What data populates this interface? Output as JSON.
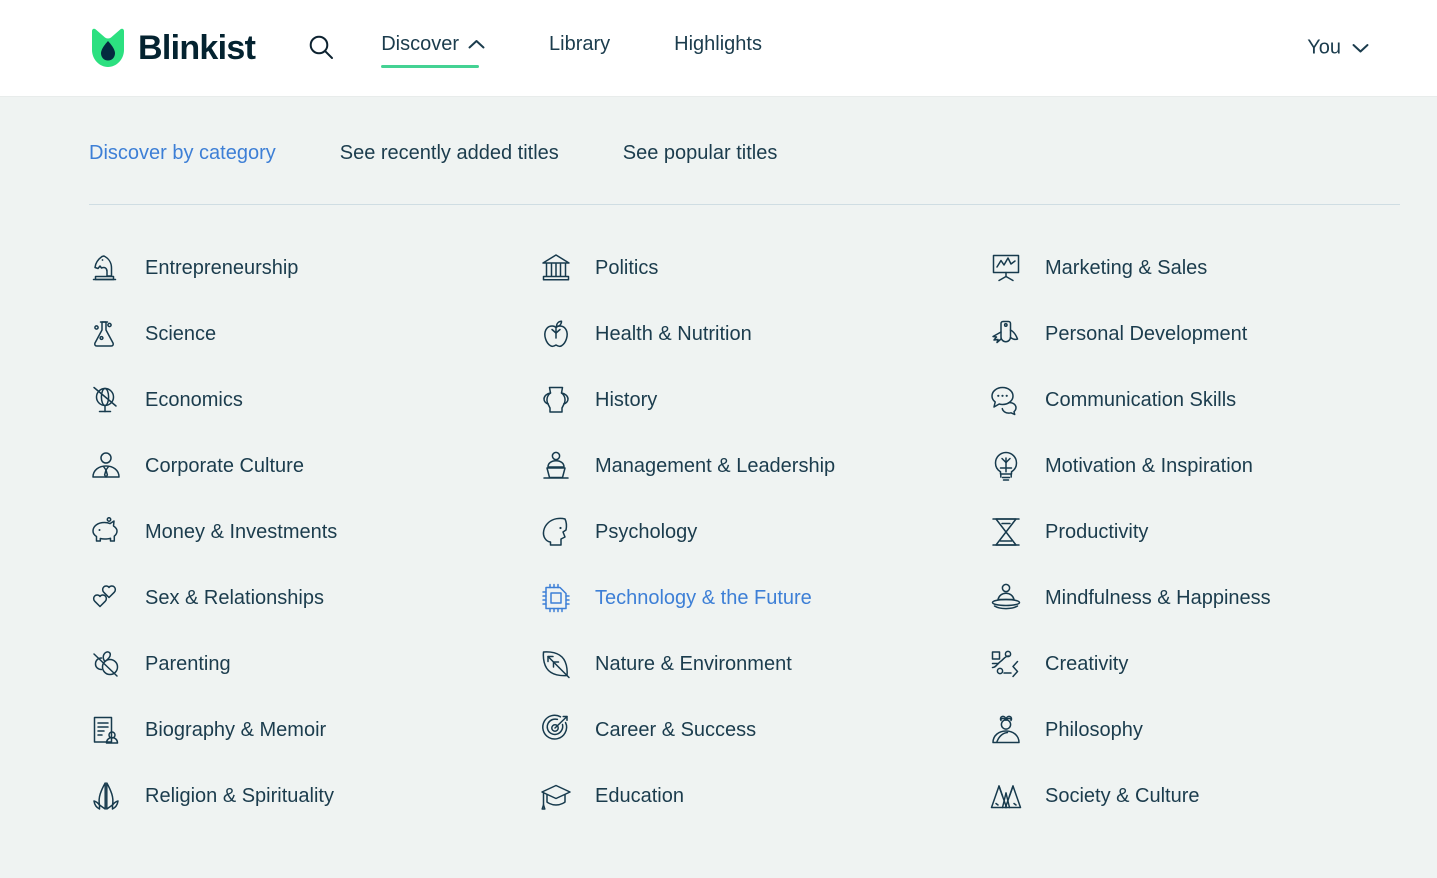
{
  "brand": {
    "name": "Blinkist",
    "logo_icon": "blinkist-droplet-logo",
    "logo_green": "#2ce080",
    "logo_navy": "#042a3f"
  },
  "header": {
    "search_icon": "search-icon",
    "nav": [
      {
        "label": "Discover",
        "icon": "chevron-up-icon",
        "active": true
      },
      {
        "label": "Library",
        "icon": "",
        "active": false
      },
      {
        "label": "Highlights",
        "icon": "",
        "active": false
      }
    ],
    "account": {
      "label": "You",
      "icon": "chevron-down-icon"
    },
    "accent_underline": "#44d293"
  },
  "subnav": {
    "items": [
      {
        "label": "Discover by category",
        "current": true
      },
      {
        "label": "See recently added titles",
        "current": false
      },
      {
        "label": "See popular titles",
        "current": false
      }
    ],
    "active_color": "#3d7fd6"
  },
  "categories": {
    "column1": [
      {
        "label": "Entrepreneurship",
        "icon": "chess-knight-icon",
        "highlight": false
      },
      {
        "label": "Science",
        "icon": "flask-icon",
        "highlight": false
      },
      {
        "label": "Economics",
        "icon": "globe-stand-icon",
        "highlight": false
      },
      {
        "label": "Corporate Culture",
        "icon": "person-tie-icon",
        "highlight": false
      },
      {
        "label": "Money & Investments",
        "icon": "piggy-bank-icon",
        "highlight": false
      },
      {
        "label": "Sex & Relationships",
        "icon": "two-hearts-icon",
        "highlight": false
      },
      {
        "label": "Parenting",
        "icon": "pacifier-icon",
        "highlight": false
      },
      {
        "label": "Biography & Memoir",
        "icon": "document-person-icon",
        "highlight": false
      },
      {
        "label": "Religion & Spirituality",
        "icon": "praying-hands-icon",
        "highlight": false
      }
    ],
    "column2": [
      {
        "label": "Politics",
        "icon": "classical-building-icon",
        "highlight": false
      },
      {
        "label": "Health & Nutrition",
        "icon": "apple-icon",
        "highlight": false
      },
      {
        "label": "History",
        "icon": "amphora-vase-icon",
        "highlight": false
      },
      {
        "label": "Management & Leadership",
        "icon": "podium-speaker-icon",
        "highlight": false
      },
      {
        "label": "Psychology",
        "icon": "head-profile-icon",
        "highlight": false
      },
      {
        "label": "Technology & the Future",
        "icon": "microchip-icon",
        "highlight": true
      },
      {
        "label": "Nature & Environment",
        "icon": "leaf-icon",
        "highlight": false
      },
      {
        "label": "Career & Success",
        "icon": "target-arrow-icon",
        "highlight": false
      },
      {
        "label": "Education",
        "icon": "graduation-cap-icon",
        "highlight": false
      }
    ],
    "column3": [
      {
        "label": "Marketing & Sales",
        "icon": "presentation-chart-icon",
        "highlight": false
      },
      {
        "label": "Personal Development",
        "icon": "swiss-army-knife-icon",
        "highlight": false
      },
      {
        "label": "Communication Skills",
        "icon": "speech-bubbles-icon",
        "highlight": false
      },
      {
        "label": "Motivation & Inspiration",
        "icon": "lightbulb-icon",
        "highlight": false
      },
      {
        "label": "Productivity",
        "icon": "hourglass-icon",
        "highlight": false
      },
      {
        "label": "Mindfulness & Happiness",
        "icon": "meditation-icon",
        "highlight": false
      },
      {
        "label": "Creativity",
        "icon": "shapes-nodes-icon",
        "highlight": false
      },
      {
        "label": "Philosophy",
        "icon": "thinker-bust-icon",
        "highlight": false
      },
      {
        "label": "Society & Culture",
        "icon": "tents-icon",
        "highlight": false
      }
    ]
  }
}
